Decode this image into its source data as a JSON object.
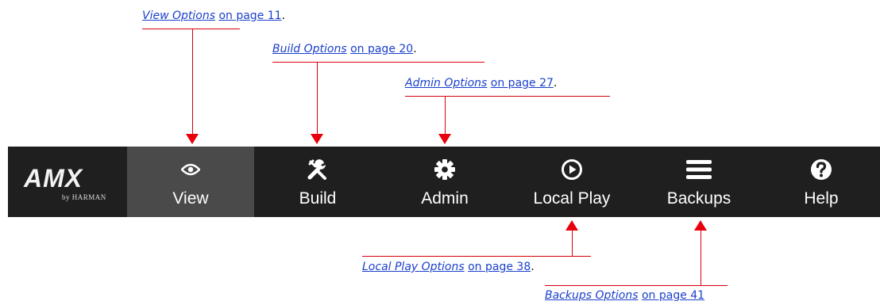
{
  "colors": {
    "link": "#1a3fcc",
    "arrow": "#e8000c",
    "navbar_bg": "#1f1f1f",
    "active_bg": "#4a4a4a"
  },
  "logo": {
    "mark": "AMX",
    "sub": "by HARMAN"
  },
  "nav": {
    "items": [
      {
        "label": "View",
        "icon": "eye-icon",
        "active": true
      },
      {
        "label": "Build",
        "icon": "tools-icon"
      },
      {
        "label": "Admin",
        "icon": "gear-icon"
      },
      {
        "label": "Local Play",
        "icon": "play-circle-icon"
      },
      {
        "label": "Backups",
        "icon": "menu-icon"
      },
      {
        "label": "Help",
        "icon": "help-icon"
      }
    ]
  },
  "callouts": {
    "view": {
      "ref": "View Options",
      "page": "on page 11",
      "punct": "."
    },
    "build": {
      "ref": "Build Options",
      "page": "on page 20",
      "punct": "."
    },
    "admin": {
      "ref": "Admin Options",
      "page": "on page 27",
      "punct": "."
    },
    "localplay": {
      "ref": "Local Play Options",
      "page": "on page 38",
      "punct": "."
    },
    "backups": {
      "ref": "Backups Options",
      "page": "on page 41",
      "punct": ""
    }
  }
}
